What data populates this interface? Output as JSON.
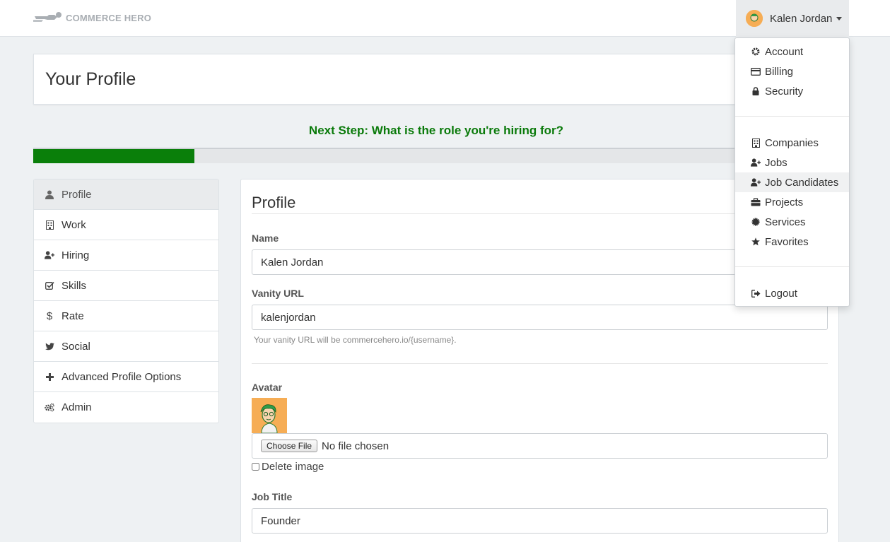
{
  "brand": {
    "name": "COMMERCE HERO",
    "icon": "superhero-flying-icon"
  },
  "user_menu": {
    "name": "Kalen Jordan",
    "avatar_icon": "cartoon-avatar"
  },
  "header": {
    "title": "Your Profile"
  },
  "progress": {
    "next_step": "Next Step: What is the role you're hiring for?",
    "fraction": 0.2,
    "color": "#0a7f0a"
  },
  "sidebar": {
    "items": [
      {
        "label": "Profile",
        "icon": "user-icon",
        "active": true
      },
      {
        "label": "Work",
        "icon": "building-icon"
      },
      {
        "label": "Hiring",
        "icon": "user-plus-icon"
      },
      {
        "label": "Skills",
        "icon": "check-square-icon"
      },
      {
        "label": "Rate",
        "icon": "dollar-icon"
      },
      {
        "label": "Social",
        "icon": "twitter-icon"
      },
      {
        "label": "Advanced Profile Options",
        "icon": "plus-icon"
      },
      {
        "label": "Admin",
        "icon": "gears-icon"
      }
    ]
  },
  "form": {
    "section_title": "Profile",
    "name_label": "Name",
    "name_value": "Kalen Jordan",
    "vanity_label": "Vanity URL",
    "vanity_value": "kalenjordan",
    "vanity_help": "Your vanity URL will be commercehero.io/{username}.",
    "avatar_label": "Avatar",
    "choose_file_label": "Choose File",
    "no_file_text": "No file chosen",
    "delete_image_label": "Delete image",
    "job_title_label": "Job Title",
    "job_title_value": "Founder"
  },
  "dropdown": {
    "group1": [
      {
        "label": "Account",
        "icon": "gear-icon"
      },
      {
        "label": "Billing",
        "icon": "credit-card-icon"
      },
      {
        "label": "Security",
        "icon": "lock-icon"
      }
    ],
    "group2": [
      {
        "label": "Companies",
        "icon": "building-icon"
      },
      {
        "label": "Jobs",
        "icon": "user-plus-icon"
      },
      {
        "label": "Job Candidates",
        "icon": "user-plus-icon",
        "highlighted": true
      },
      {
        "label": "Projects",
        "icon": "briefcase-icon"
      },
      {
        "label": "Services",
        "icon": "certificate-icon"
      },
      {
        "label": "Favorites",
        "icon": "star-icon"
      }
    ],
    "group3": [
      {
        "label": "Logout",
        "icon": "sign-out-icon"
      }
    ]
  }
}
